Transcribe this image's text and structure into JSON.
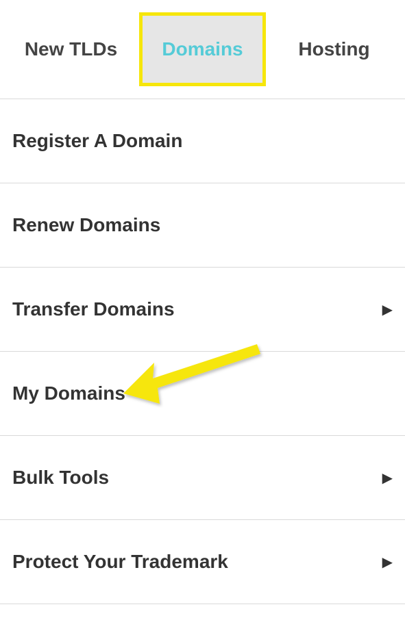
{
  "tabs": {
    "new_tlds": "New TLDs",
    "domains": "Domains",
    "hosting": "Hosting"
  },
  "menu": {
    "register": "Register A Domain",
    "renew": "Renew Domains",
    "transfer": "Transfer Domains",
    "my_domains": "My Domains",
    "bulk_tools": "Bulk Tools",
    "trademark": "Protect Your Trademark"
  },
  "annotation": {
    "highlight_tab": "domains",
    "arrow_target": "my_domains"
  }
}
